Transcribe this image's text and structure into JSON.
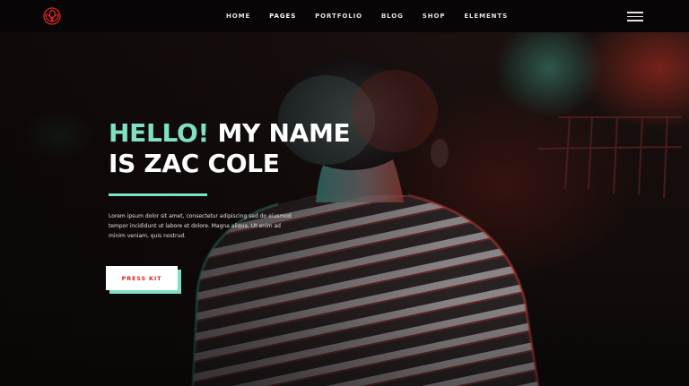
{
  "header": {
    "logo": {
      "icon": "rose-logo-icon",
      "color": "#d8262a"
    },
    "nav": [
      {
        "label": "HOME",
        "active": false
      },
      {
        "label": "PAGES",
        "active": true
      },
      {
        "label": "PORTFOLIO",
        "active": false
      },
      {
        "label": "BLOG",
        "active": false
      },
      {
        "label": "SHOP",
        "active": false
      },
      {
        "label": "ELEMENTS",
        "active": false
      }
    ],
    "menu_icon": "hamburger-menu-icon"
  },
  "hero": {
    "title_accent": "HELLO!",
    "title_rest": " MY NAME IS ZAC COLE",
    "text": "Lorem ipsum dolor sit amet, consectetur adipiscing sed do eiusmod tempor incididunt ut labore et dolore. Magna aliqua. Ut enim ad minim veniam, quis nostrud.",
    "cta_label": "PRESS KIT",
    "image": "person-striped-shirt-photo"
  },
  "colors": {
    "accent": "#7fe0c4",
    "brand_red": "#d8262a",
    "header_bg": "#070505",
    "text": "#ffffff"
  }
}
